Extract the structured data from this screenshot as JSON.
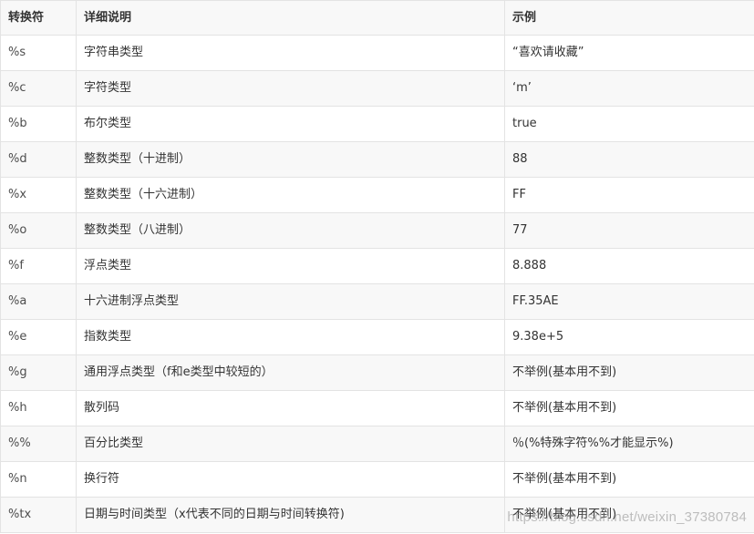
{
  "table": {
    "headers": [
      "转换符",
      "详细说明",
      "示例"
    ],
    "rows": [
      [
        "%s",
        "字符串类型",
        "“喜欢请收藏”"
      ],
      [
        "%c",
        "字符类型",
        "‘m’"
      ],
      [
        "%b",
        "布尔类型",
        "true"
      ],
      [
        "%d",
        "整数类型（十进制）",
        "88"
      ],
      [
        "%x",
        "整数类型（十六进制）",
        "FF"
      ],
      [
        "%o",
        "整数类型（八进制）",
        "77"
      ],
      [
        "%f",
        "浮点类型",
        "8.888"
      ],
      [
        "%a",
        "十六进制浮点类型",
        "FF.35AE"
      ],
      [
        "%e",
        "指数类型",
        "9.38e+5"
      ],
      [
        "%g",
        "通用浮点类型（f和e类型中较短的）",
        "不举例(基本用不到)"
      ],
      [
        "%h",
        "散列码",
        "不举例(基本用不到)"
      ],
      [
        "%%",
        "百分比类型",
        "％(%特殊字符%%才能显示%)"
      ],
      [
        "%n",
        "换行符",
        "不举例(基本用不到)"
      ],
      [
        "%tx",
        "日期与时间类型（x代表不同的日期与时间转换符)",
        "不举例(基本用不到)"
      ]
    ]
  },
  "watermark": "https://blog.csdn.net/weixin_37380784",
  "colors": {
    "border": "#e3e3e3",
    "stripe": "#f8f8f8",
    "text": "#333333"
  }
}
